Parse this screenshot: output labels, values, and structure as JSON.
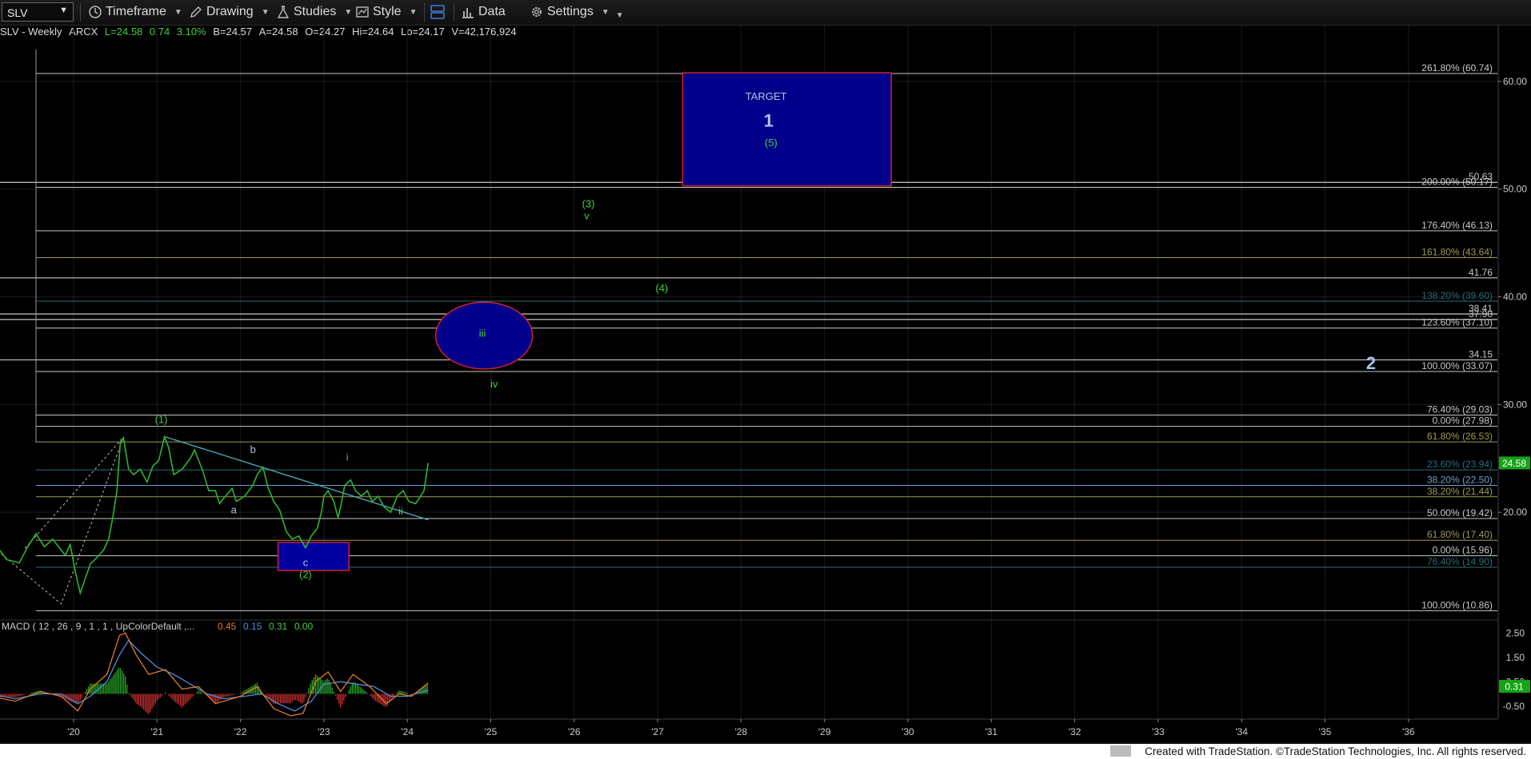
{
  "toolbar": {
    "symbol": "SLV",
    "timeframe_label": "Timeframe",
    "drawing_label": "Drawing",
    "studies_label": "Studies",
    "style_label": "Style",
    "data_label": "Data",
    "settings_label": "Settings"
  },
  "info": {
    "name": "SLV - Weekly",
    "exchange": "ARCX",
    "last": "L=24.58",
    "change": "0.74",
    "change_pct": "3.10%",
    "bid": "B=24.57",
    "ask": "A=24.58",
    "open": "O=24.27",
    "high": "Hi=24.64",
    "low": "Lo=24.17",
    "volume": "V=42,176,924"
  },
  "colors": {
    "price": "#2fb52f",
    "fib_white": "#c8c8c8",
    "fib_blue": "#6fa0c8",
    "fib_olive": "#a09a55",
    "fib_teal": "#2b6f78",
    "wave_green": "#3fcf3f",
    "wave_blue": "#a9c4e6",
    "target_fill": "#00008a",
    "target_border": "#d0202e",
    "macd_up": "#2aa52a",
    "macd_down": "#c83030",
    "macd_line": "#e07a2a",
    "signal_line": "#4d8ede"
  },
  "chart_data": {
    "type": "line",
    "title": "SLV - Weekly",
    "price_axis": {
      "min": 10,
      "max": 64,
      "ticks": [
        "60.00",
        "50.00",
        "40.00",
        "30.00",
        "20.00"
      ]
    },
    "x_ticks": [
      "'20",
      "'21",
      "'22",
      "'23",
      "'24",
      "'25",
      "'26",
      "'27",
      "'28",
      "'29",
      "'30",
      "'31",
      "'32",
      "'33",
      "'34",
      "'35",
      "'36"
    ],
    "last_price_label": "24.58",
    "price_series": [
      [
        2019.0,
        18.0
      ],
      [
        2019.1,
        16.6
      ],
      [
        2019.2,
        15.6
      ],
      [
        2019.35,
        15.3
      ],
      [
        2019.45,
        16.8
      ],
      [
        2019.55,
        18.0
      ],
      [
        2019.65,
        16.8
      ],
      [
        2019.75,
        17.5
      ],
      [
        2019.9,
        16.0
      ],
      [
        2019.96,
        17.0
      ],
      [
        2020.02,
        14.5
      ],
      [
        2020.08,
        12.5
      ],
      [
        2020.12,
        13.4
      ],
      [
        2020.2,
        15.2
      ],
      [
        2020.28,
        15.8
      ],
      [
        2020.36,
        16.5
      ],
      [
        2020.42,
        17.5
      ],
      [
        2020.47,
        19.5
      ],
      [
        2020.52,
        22.0
      ],
      [
        2020.56,
        26.5
      ],
      [
        2020.6,
        26.8
      ],
      [
        2020.66,
        24.0
      ],
      [
        2020.72,
        23.5
      ],
      [
        2020.8,
        24.0
      ],
      [
        2020.88,
        22.8
      ],
      [
        2020.95,
        24.3
      ],
      [
        2021.02,
        24.8
      ],
      [
        2021.09,
        27.0
      ],
      [
        2021.14,
        26.0
      ],
      [
        2021.2,
        23.5
      ],
      [
        2021.3,
        24.0
      ],
      [
        2021.4,
        25.0
      ],
      [
        2021.45,
        25.8
      ],
      [
        2021.55,
        23.8
      ],
      [
        2021.62,
        22.0
      ],
      [
        2021.7,
        22.0
      ],
      [
        2021.75,
        20.8
      ],
      [
        2021.82,
        21.5
      ],
      [
        2021.9,
        22.2
      ],
      [
        2021.95,
        21.0
      ],
      [
        2022.05,
        21.5
      ],
      [
        2022.15,
        22.5
      ],
      [
        2022.2,
        23.5
      ],
      [
        2022.27,
        24.2
      ],
      [
        2022.33,
        22.3
      ],
      [
        2022.4,
        21.0
      ],
      [
        2022.47,
        20.2
      ],
      [
        2022.55,
        18.2
      ],
      [
        2022.62,
        17.5
      ],
      [
        2022.7,
        17.8
      ],
      [
        2022.78,
        16.7
      ],
      [
        2022.85,
        17.8
      ],
      [
        2022.92,
        18.5
      ],
      [
        2022.97,
        20.0
      ],
      [
        2023.0,
        21.5
      ],
      [
        2023.05,
        22.0
      ],
      [
        2023.12,
        21.0
      ],
      [
        2023.17,
        19.5
      ],
      [
        2023.2,
        20.5
      ],
      [
        2023.25,
        22.5
      ],
      [
        2023.32,
        23.0
      ],
      [
        2023.38,
        22.0
      ],
      [
        2023.45,
        21.5
      ],
      [
        2023.52,
        22.0
      ],
      [
        2023.58,
        21.0
      ],
      [
        2023.65,
        21.5
      ],
      [
        2023.72,
        20.5
      ],
      [
        2023.8,
        20.0
      ],
      [
        2023.88,
        21.5
      ],
      [
        2023.95,
        22.0
      ],
      [
        2024.02,
        21.0
      ],
      [
        2024.1,
        20.8
      ],
      [
        2024.16,
        21.5
      ],
      [
        2024.2,
        22.0
      ],
      [
        2024.25,
        24.58
      ]
    ],
    "horizontal_levels": [
      {
        "label": "261.80% (60.74)",
        "value": 60.74,
        "color": "fib_white"
      },
      {
        "label": "200.00% (50.17)",
        "value": 50.17,
        "color": "fib_white"
      },
      {
        "label": "50.63",
        "value": 50.63,
        "color": "fib_white"
      },
      {
        "label": "176.40% (46.13)",
        "value": 46.13,
        "color": "fib_white"
      },
      {
        "label": "161.80% (43.64)",
        "value": 43.64,
        "color": "fib_olive"
      },
      {
        "label": "41.76",
        "value": 41.76,
        "color": "fib_white"
      },
      {
        "label": "138.20% (39.60)",
        "value": 39.6,
        "color": "fib_teal"
      },
      {
        "label": "38.41",
        "value": 38.41,
        "color": "fib_white"
      },
      {
        "label": "37.90",
        "value": 37.9,
        "color": "fib_white"
      },
      {
        "label": "123.60% (37.10)",
        "value": 37.1,
        "color": "fib_white"
      },
      {
        "label": "34.15",
        "value": 34.15,
        "color": "fib_white"
      },
      {
        "label": "100.00% (33.07)",
        "value": 33.07,
        "color": "fib_white"
      },
      {
        "label": "76.40% (29.03)",
        "value": 29.03,
        "color": "fib_white"
      },
      {
        "label": "0.00% (27.98)",
        "value": 27.98,
        "color": "fib_white"
      },
      {
        "label": "61.80% (26.53)",
        "value": 26.53,
        "color": "fib_olive"
      },
      {
        "label": "23.60% (23.94)",
        "value": 23.94,
        "color": "fib_teal"
      },
      {
        "label": "38.20% (22.50)",
        "value": 22.5,
        "color": "fib_blue"
      },
      {
        "label": "38.20% (21.44)",
        "value": 21.44,
        "color": "fib_olive"
      },
      {
        "label": "50.00% (19.42)",
        "value": 19.42,
        "color": "fib_white"
      },
      {
        "label": "61.80% (17.40)",
        "value": 17.4,
        "color": "fib_olive"
      },
      {
        "label": "0.00% (15.96)",
        "value": 15.96,
        "color": "fib_white"
      },
      {
        "label": "76.40% (14.90)",
        "value": 14.9,
        "color": "fib_teal"
      },
      {
        "label": "100.00% (10.86)",
        "value": 10.86,
        "color": "fib_white"
      }
    ],
    "annotations": [
      {
        "text": "TARGET",
        "x": 2028.3,
        "y": 58.3,
        "color": "wave_blue",
        "size": "sm"
      },
      {
        "text": "1",
        "x": 2028.33,
        "y": 55.8,
        "color": "wave_blue",
        "size": "lg"
      },
      {
        "text": "(5)",
        "x": 2028.36,
        "y": 54.0,
        "color": "wave_green",
        "size": "sm"
      },
      {
        "text": "(3)",
        "x": 2026.17,
        "y": 48.3,
        "color": "wave_green",
        "size": "sm"
      },
      {
        "text": "v",
        "x": 2026.15,
        "y": 47.2,
        "color": "wave_green",
        "size": "sm"
      },
      {
        "text": "(4)",
        "x": 2027.05,
        "y": 40.5,
        "color": "wave_green",
        "size": "sm"
      },
      {
        "text": "iii",
        "x": 2024.9,
        "y": 36.3,
        "color": "wave_green",
        "size": "sm"
      },
      {
        "text": "iv",
        "x": 2025.04,
        "y": 31.6,
        "color": "wave_green",
        "size": "sm"
      },
      {
        "text": "2",
        "x": 2035.55,
        "y": 33.3,
        "color": "wave_blue",
        "size": "lg"
      },
      {
        "text": "(1)",
        "x": 2021.05,
        "y": 28.3,
        "color": "wave_green",
        "size": "sm"
      },
      {
        "text": "b",
        "x": 2022.15,
        "y": 25.5,
        "color": "wave_blue",
        "size": "sm"
      },
      {
        "text": "i",
        "x": 2023.28,
        "y": 24.8,
        "color": "wave_green",
        "size": "sm"
      },
      {
        "text": "a",
        "x": 2021.92,
        "y": 19.9,
        "color": "wave_blue",
        "size": "sm"
      },
      {
        "text": "ii",
        "x": 2023.92,
        "y": 19.8,
        "color": "wave_green",
        "size": "sm"
      },
      {
        "text": "c",
        "x": 2022.78,
        "y": 15.0,
        "color": "wave_blue",
        "size": "sm"
      },
      {
        "text": "(2)",
        "x": 2022.78,
        "y": 13.9,
        "color": "wave_green",
        "size": "sm"
      }
    ],
    "target_box": {
      "x1": 2027.3,
      "x2": 2029.8,
      "y_top": 60.8,
      "y_bottom": 50.3
    },
    "c_box": {
      "x1": 2022.45,
      "x2": 2023.3,
      "y_top": 17.2,
      "y_bottom": 14.6
    },
    "ellipse": {
      "cx": 2024.92,
      "cy": 36.4,
      "rx": 0.58,
      "ry": 3.1
    },
    "trendline": {
      "x1": 2021.1,
      "y1": 27.0,
      "x2": 2024.25,
      "y2": 19.3
    },
    "dotted_line": [
      [
        2019.0,
        17.0
      ],
      [
        2019.85,
        11.5
      ],
      [
        2020.6,
        27.0
      ],
      [
        2019.4,
        16.5
      ]
    ],
    "macd": {
      "title": "MACD ( 12 , 26 , 9 , 1 , 1 , UpColorDefault ,...",
      "values": [
        "0.45",
        "0.15",
        "0.31",
        "0.00"
      ],
      "axis": {
        "min": -1.0,
        "max": 3.0,
        "ticks": [
          "2.50",
          "1.50",
          "0.50",
          "-0.50"
        ]
      },
      "last_label": "0.31",
      "macd_line": [
        [
          2019.0,
          -0.1
        ],
        [
          2019.3,
          -0.3
        ],
        [
          2019.6,
          0.1
        ],
        [
          2019.85,
          -0.1
        ],
        [
          2020.05,
          -0.7
        ],
        [
          2020.2,
          0.2
        ],
        [
          2020.4,
          0.8
        ],
        [
          2020.55,
          2.4
        ],
        [
          2020.62,
          2.5
        ],
        [
          2020.75,
          1.6
        ],
        [
          2020.9,
          0.8
        ],
        [
          2021.1,
          1.0
        ],
        [
          2021.3,
          0.2
        ],
        [
          2021.5,
          0.3
        ],
        [
          2021.7,
          -0.4
        ],
        [
          2022.0,
          -0.1
        ],
        [
          2022.2,
          0.3
        ],
        [
          2022.4,
          -0.6
        ],
        [
          2022.6,
          -0.9
        ],
        [
          2022.75,
          -0.8
        ],
        [
          2022.9,
          0.5
        ],
        [
          2023.05,
          0.9
        ],
        [
          2023.2,
          0.1
        ],
        [
          2023.35,
          0.8
        ],
        [
          2023.55,
          0.3
        ],
        [
          2023.75,
          -0.4
        ],
        [
          2023.9,
          0.0
        ],
        [
          2024.05,
          -0.1
        ],
        [
          2024.25,
          0.45
        ]
      ],
      "signal_line": [
        [
          2019.0,
          0.0
        ],
        [
          2019.3,
          -0.2
        ],
        [
          2019.6,
          0.0
        ],
        [
          2019.85,
          0.0
        ],
        [
          2020.05,
          -0.4
        ],
        [
          2020.2,
          -0.1
        ],
        [
          2020.4,
          0.5
        ],
        [
          2020.55,
          1.6
        ],
        [
          2020.66,
          2.2
        ],
        [
          2020.8,
          1.7
        ],
        [
          2021.0,
          1.1
        ],
        [
          2021.2,
          0.8
        ],
        [
          2021.4,
          0.4
        ],
        [
          2021.6,
          0.0
        ],
        [
          2021.8,
          -0.2
        ],
        [
          2022.05,
          -0.1
        ],
        [
          2022.25,
          0.0
        ],
        [
          2022.45,
          -0.4
        ],
        [
          2022.65,
          -0.7
        ],
        [
          2022.85,
          -0.3
        ],
        [
          2023.0,
          0.4
        ],
        [
          2023.2,
          0.5
        ],
        [
          2023.4,
          0.4
        ],
        [
          2023.6,
          0.3
        ],
        [
          2023.8,
          -0.1
        ],
        [
          2024.0,
          -0.1
        ],
        [
          2024.25,
          0.15
        ]
      ]
    }
  },
  "footer": {
    "text": "Created with TradeStation. ©TradeStation Technologies, Inc. All rights reserved."
  }
}
